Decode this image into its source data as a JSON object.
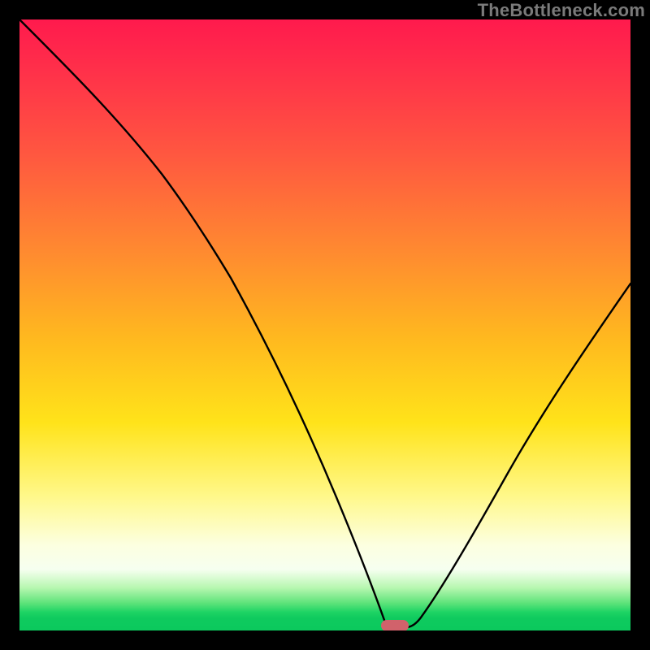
{
  "watermark": {
    "text": "TheBottleneck.com"
  },
  "chart_data": {
    "type": "line",
    "title": "",
    "xlabel": "",
    "ylabel": "",
    "xlim": [
      0,
      100
    ],
    "ylim": [
      0,
      100
    ],
    "grid": false,
    "legend": false,
    "series": [
      {
        "name": "bottleneck-curve",
        "x": [
          0,
          6,
          12,
          18,
          24,
          30,
          36,
          42,
          48,
          54,
          58,
          60,
          61,
          62,
          64,
          66,
          70,
          76,
          82,
          88,
          94,
          100
        ],
        "values": [
          100,
          92,
          84,
          76,
          67,
          56,
          46,
          35,
          24,
          12,
          4,
          1,
          0,
          0,
          1,
          3,
          8,
          17,
          27,
          37,
          47,
          57
        ]
      }
    ],
    "marker": {
      "name": "optimal-point",
      "x": 61.5,
      "y": 0.6,
      "color": "#d1626b"
    },
    "background_gradient": {
      "top": "#ff1a4d",
      "mid": "#ffe31a",
      "bottom": "#0bc95d"
    }
  }
}
